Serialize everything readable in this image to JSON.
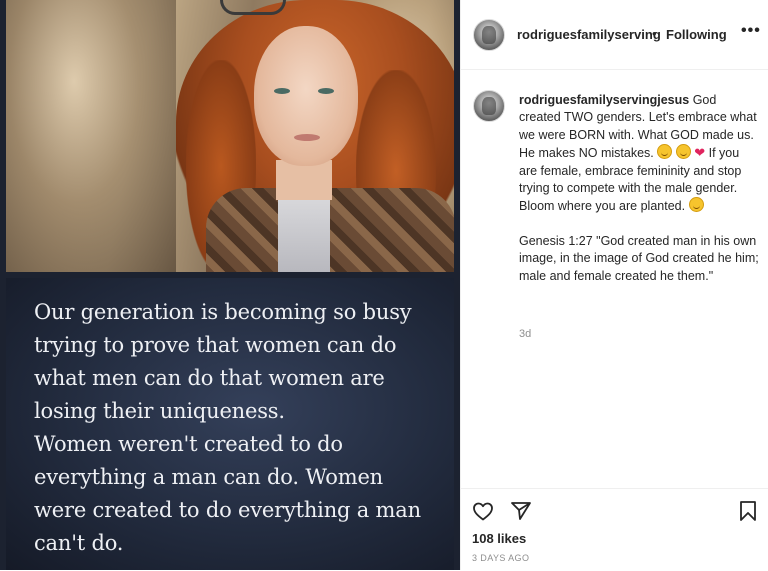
{
  "post": {
    "quote_lines": [
      "Our generation is becoming so busy",
      "trying to prove that women can do",
      "what men can do that women are",
      "losing their uniqueness.",
      "Women weren't created to do",
      "everything a man can do. Women",
      "were created to do everything a man",
      "can't do."
    ]
  },
  "header": {
    "username": "rodriguesfamilyserving",
    "separator": "•",
    "follow_status": "Following",
    "more_label": "•••"
  },
  "caption": {
    "username": "rodriguesfamilyservingjesus",
    "text_1": "God created TWO genders. Let's embrace what we were BORN with. What GOD made us. He makes NO mistakes.",
    "text_2": "If you are female, embrace femininity and stop trying to compete with the male gender. Bloom where you are planted.",
    "text_3": "Genesis 1:27 \"God created man in his own image, in the image of God created he him; male and female created he them.\"",
    "heart": "❤",
    "time": "3d"
  },
  "actions": {
    "likes": "108 likes",
    "date": "3 DAYS AGO"
  },
  "icons": {
    "like": "heart-outline-icon",
    "share": "paper-plane-icon",
    "save": "bookmark-icon"
  }
}
